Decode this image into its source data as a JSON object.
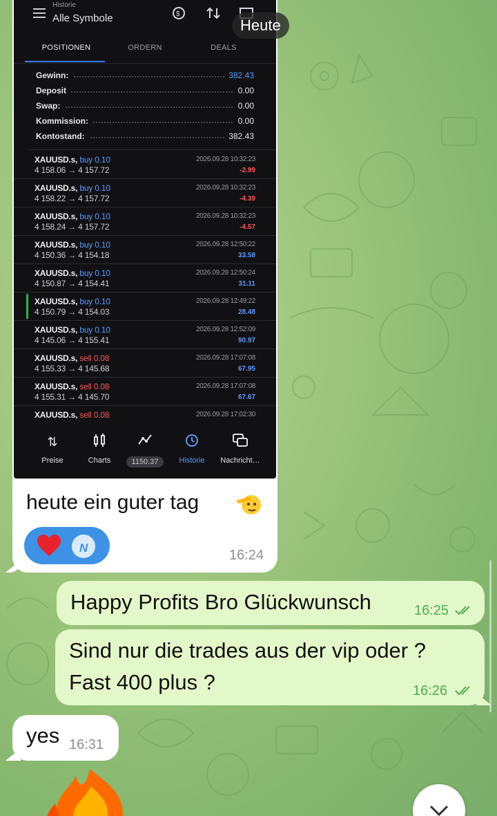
{
  "overlay_date": "Heute",
  "screenshot": {
    "breadcrumb": "Historie",
    "title": "Alle Symbole",
    "tabs": [
      "POSITIONEN",
      "ORDERN",
      "DEALS"
    ],
    "summary": [
      {
        "label": "Gewinn:",
        "value": "382.43",
        "highlight": true
      },
      {
        "label": "Deposit",
        "value": "0.00",
        "highlight": false
      },
      {
        "label": "Swap:",
        "value": "0.00",
        "highlight": false
      },
      {
        "label": "Kommission:",
        "value": "0.00",
        "highlight": false
      },
      {
        "label": "Kontostand:",
        "value": "382.43",
        "highlight": false
      }
    ],
    "deals": [
      {
        "symbol": "XAUUSD.s,",
        "side": "buy 0.10",
        "prices": "4 158.06 → 4 157.72",
        "time": "2026.09.28 10:32:23",
        "pl": "-2.99"
      },
      {
        "symbol": "XAUUSD.s,",
        "side": "buy 0.10",
        "prices": "4 158.22 → 4 157.72",
        "time": "2026.09.28 10:32:23",
        "pl": "-4.39"
      },
      {
        "symbol": "XAUUSD.s,",
        "side": "buy 0.10",
        "prices": "4 158.24 → 4 157.72",
        "time": "2026.09.28 10:32:23",
        "pl": "-4.57"
      },
      {
        "symbol": "XAUUSD.s,",
        "side": "buy 0.10",
        "prices": "4 150.36 → 4 154.18",
        "time": "2026.09.28 12:50:22",
        "pl": "33.58"
      },
      {
        "symbol": "XAUUSD.s,",
        "side": "buy 0.10",
        "prices": "4 150.87 → 4 154.41",
        "time": "2026.09.28 12:50:24",
        "pl": "31.11"
      },
      {
        "symbol": "XAUUSD.s,",
        "side": "buy 0.10",
        "prices": "4 150.79 → 4 154.03",
        "time": "2026.09.28 12:49:22",
        "pl": "28.48"
      },
      {
        "symbol": "XAUUSD.s,",
        "side": "buy 0.10",
        "prices": "4 145.06 → 4 155.41",
        "time": "2026.09.28 12:52:09",
        "pl": "90.97"
      },
      {
        "symbol": "XAUUSD.s,",
        "side": "sell 0.08",
        "prices": "4 155.33 → 4 145.68",
        "time": "2026.09.28 17:07:08",
        "pl": "67.95"
      },
      {
        "symbol": "XAUUSD.s,",
        "side": "sell 0.08",
        "prices": "4 155.31 → 4 145.70",
        "time": "2026.09.28 17:07:08",
        "pl": "67.67"
      },
      {
        "symbol": "XAUUSD.s,",
        "side": "sell 0.08",
        "prices": "",
        "time": "2026.09.28 17:02:30",
        "pl": ""
      }
    ],
    "bottom_nav": [
      {
        "label": "Preise",
        "icon": "arrows-updown-icon"
      },
      {
        "label": "Charts",
        "icon": "candlestick-icon"
      },
      {
        "label": "1150.37",
        "icon": "trade-line-icon"
      },
      {
        "label": "Historie",
        "icon": "history-icon"
      },
      {
        "label": "Nachricht…",
        "icon": "messages-icon"
      }
    ]
  },
  "messages": {
    "first_caption": "heute ein guter tag",
    "first_time": "16:24",
    "reaction_avatar": "N",
    "m2_text": "Happy Profits Bro Glückwunsch",
    "m2_time": "16:25",
    "m3_line1": "Sind nur die trades aus der vip oder ?",
    "m3_line2": "Fast 400 plus ?",
    "m3_time": "16:26",
    "m4_text": "yes",
    "m4_time": "16:31"
  },
  "colors": {
    "outgoing_bubble": "#e3f8c9",
    "incoming_bubble": "#ffffff",
    "read_check": "#4fae4e",
    "mt_blue": "#5a9bff",
    "mt_red": "#ff5a5a",
    "reaction_blue": "#3d92e6"
  }
}
